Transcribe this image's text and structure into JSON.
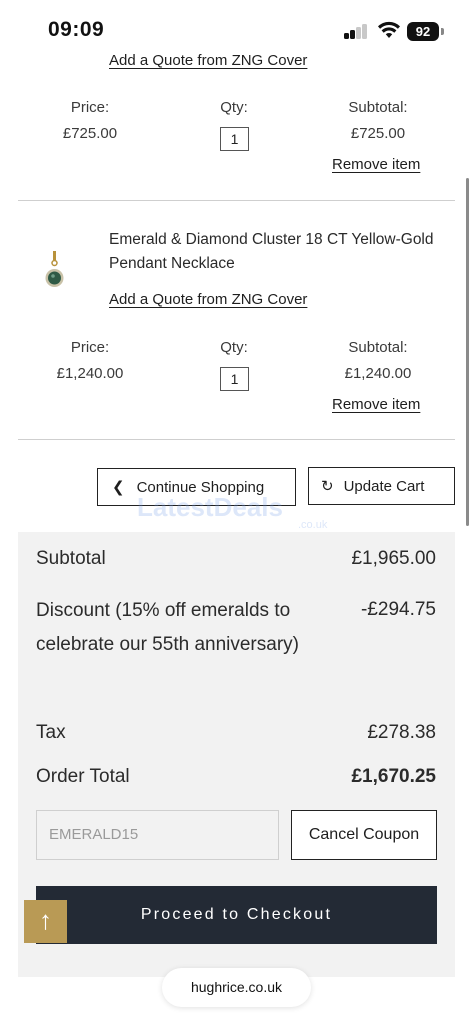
{
  "status_bar": {
    "time": "09:09",
    "battery": "92"
  },
  "cart": {
    "top_quote_link": "Add a Quote from ZNG Cover",
    "item1": {
      "price_label": "Price:",
      "qty_label": "Qty:",
      "subtotal_label": "Subtotal:",
      "price": "£725.00",
      "qty": "1",
      "subtotal": "£725.00",
      "remove_label": "Remove item"
    },
    "item2": {
      "name": "Emerald & Diamond Cluster 18 CT Yellow-Gold Pendant Necklace",
      "quote_link": "Add a Quote from ZNG Cover",
      "price_label": "Price:",
      "qty_label": "Qty:",
      "subtotal_label": "Subtotal:",
      "price": "£1,240.00",
      "qty": "1",
      "subtotal": "£1,240.00",
      "remove_label": "Remove item"
    },
    "continue_label": "Continue Shopping",
    "update_label": "Update Cart"
  },
  "watermark": {
    "text": "LatestDeals",
    "sub": ".co.uk"
  },
  "summary": {
    "subtotal_label": "Subtotal",
    "subtotal_value": "£1,965.00",
    "discount_label": "Discount (15% off emeralds to celebrate our 55th anniversary)",
    "discount_value": "-£294.75",
    "tax_label": "Tax",
    "tax_value": "£278.38",
    "total_label": "Order Total",
    "total_value": "£1,670.25",
    "coupon_value": "EMERALD15",
    "cancel_coupon_label": "Cancel Coupon",
    "checkout_label": "Proceed to Checkout"
  },
  "browser": {
    "url": "hughrice.co.uk"
  },
  "colors": {
    "checkout_bg": "#232a35",
    "scroll_top_bg": "#b99a55",
    "summary_bg": "#f2f2f2"
  },
  "icons": {
    "continue": "chevron-left-icon",
    "update": "refresh-icon",
    "scroll_top": "arrow-up-icon"
  }
}
